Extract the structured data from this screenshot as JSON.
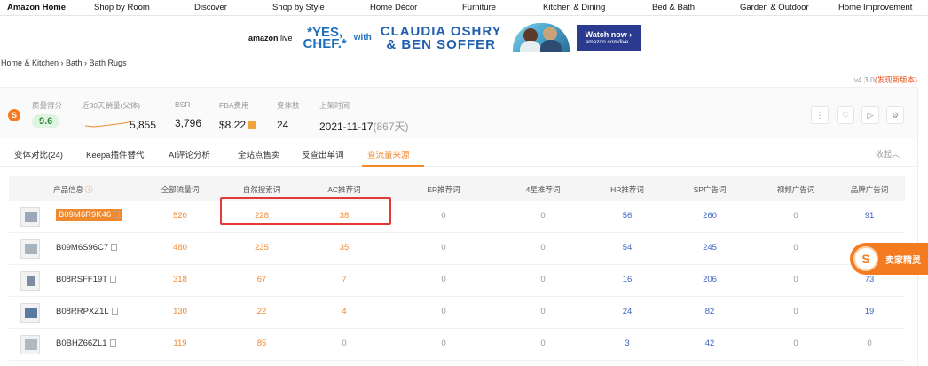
{
  "topnav": {
    "items": [
      "Amazon Home",
      "Shop by Room",
      "Discover",
      "Shop by Style",
      "Home Décor",
      "Furniture",
      "Kitchen & Dining",
      "Bed & Bath",
      "Garden & Outdoor",
      "Home Improvement"
    ]
  },
  "banner": {
    "logo": "amazon",
    "logo_suffix": "live",
    "yes_line1": "*YES,",
    "yes_line2": "CHEF.*",
    "with": "with",
    "names_line1": "CLAUDIA OSHRY",
    "names_line2": "& BEN SOFFER",
    "watch_title": "Watch now ›",
    "watch_url": "amazon.com/live"
  },
  "breadcrumb": "Home & Kitchen › Bath › Bath Rugs",
  "version": {
    "text": "v4.3.0",
    "new_text": "(发现新版本)"
  },
  "stats": {
    "quality_label": "质量得分",
    "quality_value": "9.6",
    "sales_label": "近30天销量(父体)",
    "sales_value": "5,855",
    "bsr_label": "BSR",
    "bsr_value": "3,796",
    "fba_label": "FBA费用",
    "fba_value": "$8.22",
    "variants_label": "变体数",
    "variants_value": "24",
    "listed_label": "上架时间",
    "listed_value": "2021-11-17",
    "listed_days": "(867天)"
  },
  "tabs": {
    "items": [
      "变体对比(24)",
      "Keepa插件替代",
      "AI评论分析",
      "全站点售卖",
      "反查出单词",
      "查流量来源"
    ],
    "active_index": 5,
    "collapse": "收起︿"
  },
  "table": {
    "headers": [
      "产品信息",
      "全部流量词",
      "自然搜索词",
      "AC推荐词",
      "ER推荐词",
      "4星推荐词",
      "HR推荐词",
      "SP广告词",
      "视频广告词",
      "品牌广告词"
    ],
    "info_icon": "?",
    "rows": [
      {
        "asin": "B09M6R9K46",
        "highlight": true,
        "values": [
          "520",
          "228",
          "38",
          "0",
          "0",
          "56",
          "260",
          "0",
          "91"
        ]
      },
      {
        "asin": "B09M6S96C7",
        "highlight": false,
        "values": [
          "480",
          "235",
          "35",
          "0",
          "0",
          "54",
          "245",
          "0",
          ""
        ]
      },
      {
        "asin": "B08RSFF19T",
        "highlight": false,
        "values": [
          "318",
          "67",
          "7",
          "0",
          "0",
          "16",
          "206",
          "0",
          "73"
        ]
      },
      {
        "asin": "B08RRPXZ1L",
        "highlight": false,
        "values": [
          "130",
          "22",
          "4",
          "0",
          "0",
          "24",
          "82",
          "0",
          "19"
        ]
      },
      {
        "asin": "B0BHZ66ZL1",
        "highlight": false,
        "values": [
          "119",
          "85",
          "0",
          "0",
          "0",
          "3",
          "42",
          "0",
          "0"
        ]
      }
    ]
  },
  "sprite": {
    "logo": "S",
    "label": "卖家精灵"
  },
  "colors": {
    "accent": "#f0882e",
    "blue": "#3b63c4",
    "highlight_box": "#e53935"
  }
}
